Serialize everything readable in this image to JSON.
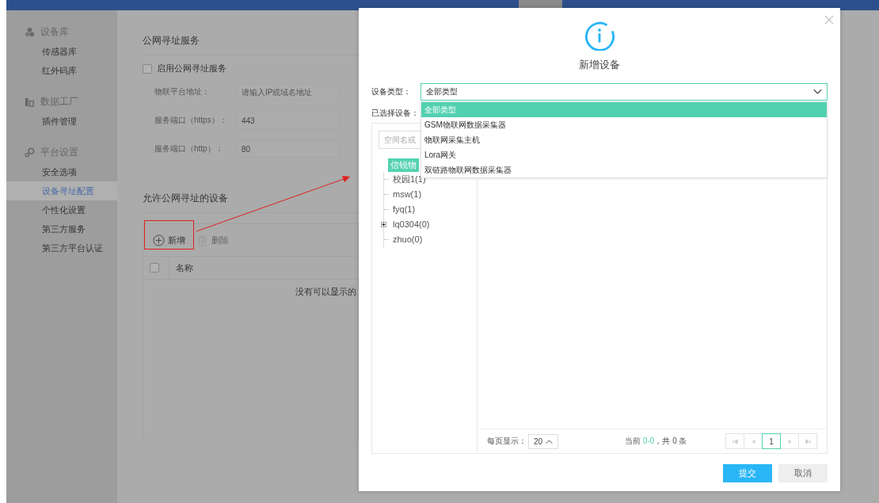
{
  "sidebar": {
    "groups": [
      {
        "title": "设备库",
        "kind": "devices",
        "items": [
          {
            "label": "传感器库",
            "selected": false
          },
          {
            "label": "红外码库",
            "selected": false
          }
        ]
      },
      {
        "title": "数据工厂",
        "kind": "factory",
        "items": [
          {
            "label": "插件管理",
            "selected": false
          }
        ]
      },
      {
        "title": "平台设置",
        "kind": "settings",
        "items": [
          {
            "label": "安全选项",
            "selected": false
          },
          {
            "label": "设备寻址配置",
            "selected": true
          },
          {
            "label": "个性化设置",
            "selected": false
          },
          {
            "label": "第三方服务",
            "selected": false
          },
          {
            "label": "第三方平台认证",
            "selected": false
          }
        ]
      }
    ]
  },
  "service_section": {
    "title": "公网寻址服务",
    "enable": {
      "label": "启用公网寻址服务",
      "checked": false
    },
    "fields": [
      {
        "label": "物联平台地址：",
        "placeholder": "请输入IP或域名地址"
      },
      {
        "label": "服务端口（https）：",
        "value": "443"
      },
      {
        "label": "服务端口（http）：",
        "value": "80"
      }
    ]
  },
  "devices_section": {
    "title": "允许公网寻址的设备",
    "toolbar": [
      {
        "label": "新增",
        "kind": "add",
        "disabled": false
      },
      {
        "label": "删除",
        "kind": "delete",
        "disabled": true
      }
    ],
    "table": {
      "header_checkbox": {
        "checked": false
      },
      "columns": [
        "名称"
      ],
      "empty_text": "没有可以显示的"
    }
  },
  "dialog": {
    "title": "新增设备",
    "type_field": {
      "label": "设备类型：",
      "value": "全部类型",
      "expanded": true,
      "options": [
        {
          "label": "全部类型",
          "selected": true
        },
        {
          "label": "GSM物联网数据采集器",
          "selected": false
        },
        {
          "label": "物联网采集主机",
          "selected": false
        },
        {
          "label": "Lora网关",
          "selected": false
        },
        {
          "label": "双链路物联网数据采集器",
          "selected": false
        }
      ]
    },
    "selected_label": "已选择设备：",
    "search": {
      "placeholder": "空间名或"
    },
    "tree": [
      {
        "label": "信锐物",
        "selected": true,
        "children": [
          {
            "label": "校园1(1)",
            "selected": false,
            "collapsed": false
          },
          {
            "label": "msw(1)",
            "selected": false,
            "collapsed": false
          },
          {
            "label": "fyq(1)",
            "selected": false,
            "collapsed": false
          },
          {
            "label": "lq0304(0)",
            "selected": false,
            "collapsed": true
          },
          {
            "label": "zhuo(0)",
            "selected": false,
            "collapsed": false
          }
        ]
      }
    ],
    "page_size_label": "每页显示：",
    "page_size": "20",
    "summary": {
      "prefix": "当前 ",
      "range": "0-0",
      "suffix": "，共 0 条"
    },
    "pages": [
      {
        "label": "1",
        "selected": true
      }
    ],
    "buttons": [
      {
        "label": "提交",
        "kind": "primary"
      },
      {
        "label": "取消",
        "kind": "secondary"
      }
    ]
  }
}
